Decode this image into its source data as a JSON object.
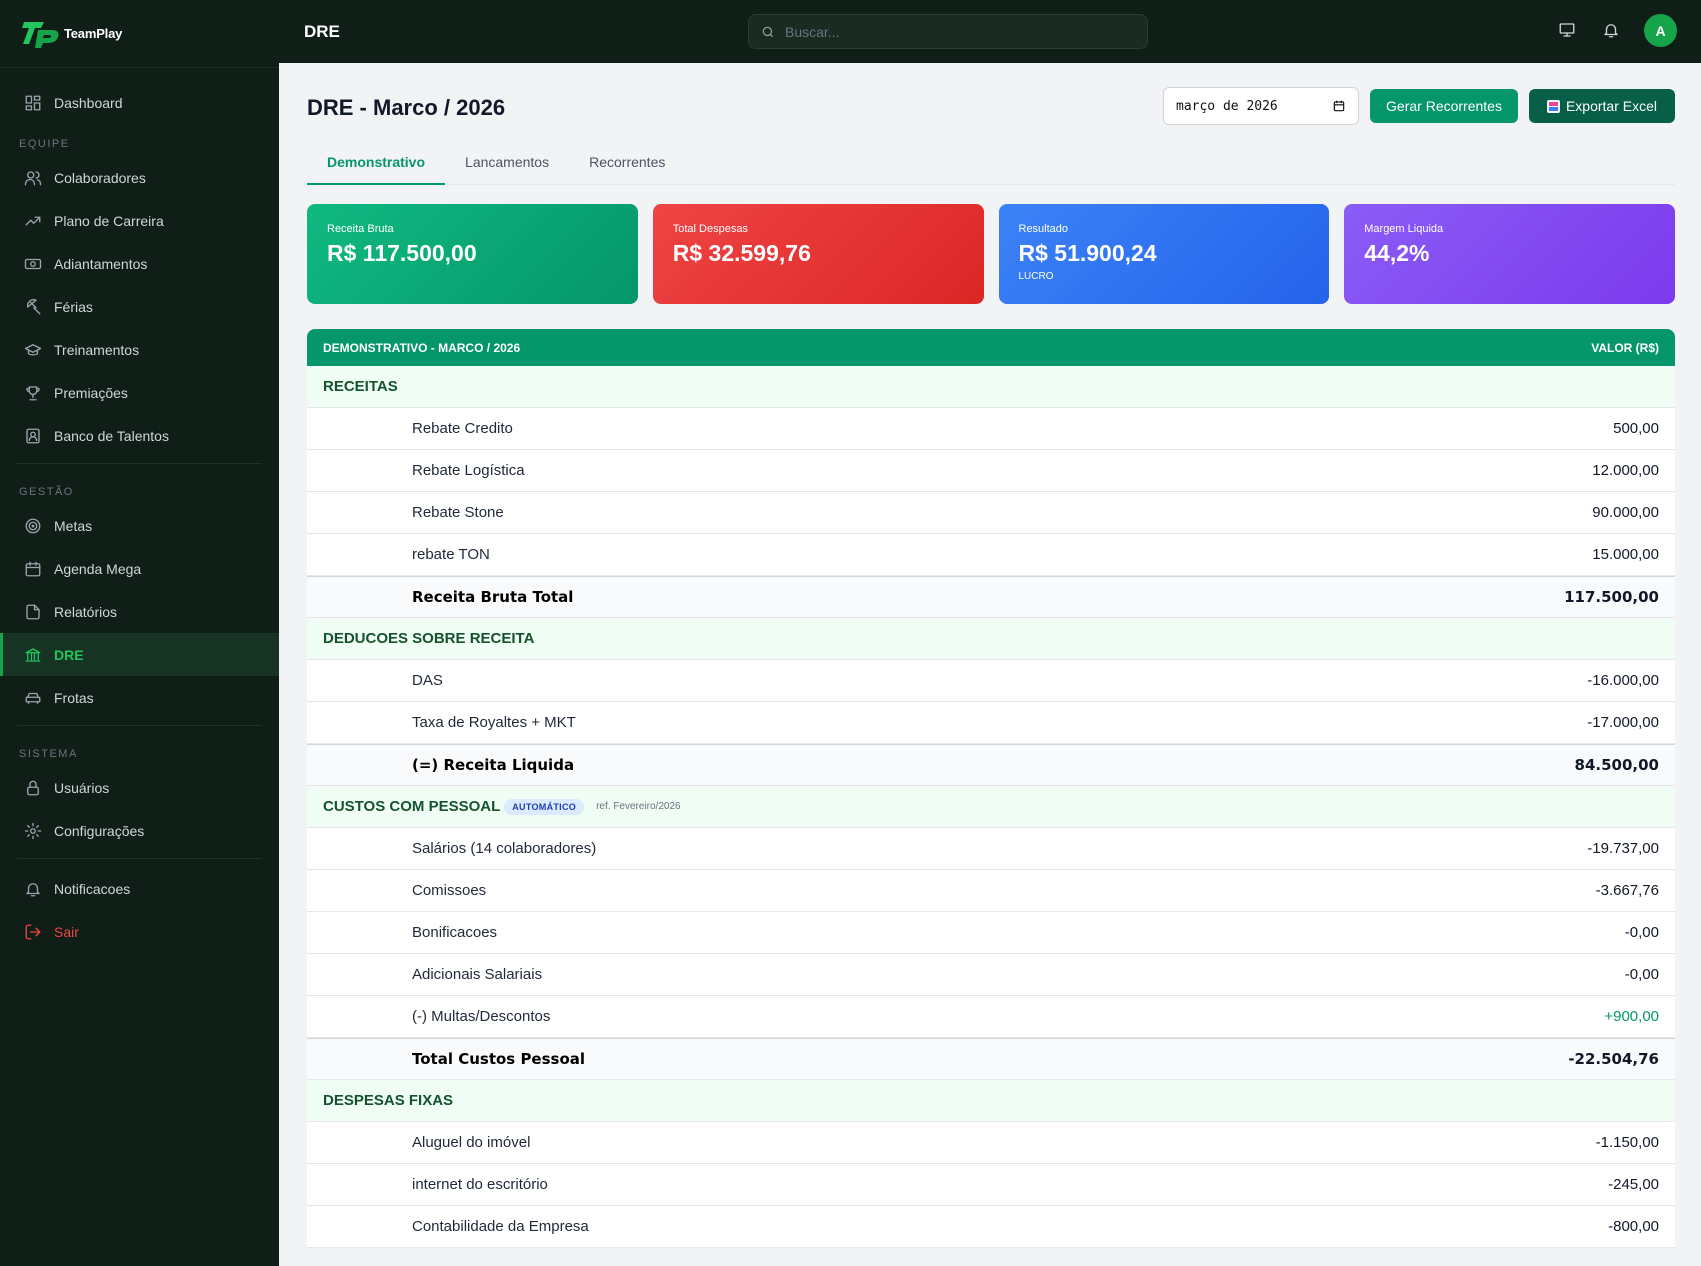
{
  "brand": {
    "name": "TeamPlay"
  },
  "sidebar": {
    "top": [
      {
        "label": "Dashboard",
        "icon": "dashboard-icon"
      }
    ],
    "equipe_title": "EQUIPE",
    "equipe": [
      {
        "label": "Colaboradores",
        "icon": "users-icon"
      },
      {
        "label": "Plano de Carreira",
        "icon": "trending-up-icon"
      },
      {
        "label": "Adiantamentos",
        "icon": "banknote-icon"
      },
      {
        "label": "Férias",
        "icon": "umbrella-icon"
      },
      {
        "label": "Treinamentos",
        "icon": "graduation-cap-icon"
      },
      {
        "label": "Premiações",
        "icon": "trophy-icon"
      },
      {
        "label": "Banco de Talentos",
        "icon": "contact-icon"
      }
    ],
    "gestao_title": "GESTÃO",
    "gestao": [
      {
        "label": "Metas",
        "icon": "target-icon"
      },
      {
        "label": "Agenda Mega",
        "icon": "calendar-icon"
      },
      {
        "label": "Relatórios",
        "icon": "file-icon"
      },
      {
        "label": "DRE",
        "icon": "bank-icon",
        "active": true
      },
      {
        "label": "Frotas",
        "icon": "car-icon"
      }
    ],
    "sistema_title": "SISTEMA",
    "sistema": [
      {
        "label": "Usuários",
        "icon": "lock-icon"
      },
      {
        "label": "Configurações",
        "icon": "gear-icon"
      }
    ],
    "bottom": [
      {
        "label": "Notificacoes",
        "icon": "bell-icon"
      },
      {
        "label": "Sair",
        "icon": "logout-icon"
      }
    ]
  },
  "topbar": {
    "title": "DRE",
    "search_placeholder": "Buscar...",
    "avatar": "A"
  },
  "page": {
    "title": "DRE - Marco / 2026",
    "month": "março de 2026",
    "btn_recorrentes": "Gerar Recorrentes",
    "btn_export": "Exportar Excel",
    "tabs": [
      "Demonstrativo",
      "Lancamentos",
      "Recorrentes"
    ]
  },
  "cards": [
    {
      "label": "Receita Bruta",
      "value": "R$ 117.500,00",
      "sub": ""
    },
    {
      "label": "Total Despesas",
      "value": "R$ 32.599,76",
      "sub": ""
    },
    {
      "label": "Resultado",
      "value": "R$ 51.900,24",
      "sub": "LUCRO"
    },
    {
      "label": "Margem Liquida",
      "value": "44,2%",
      "sub": ""
    }
  ],
  "table": {
    "head_left": "DEMONSTRATIVO - MARCO / 2026",
    "head_right": "VALOR (R$)",
    "receitas": {
      "title": "RECEITAS",
      "rows": [
        {
          "label": "Rebate Credito",
          "value": "500,00"
        },
        {
          "label": "Rebate Logística",
          "value": "12.000,00"
        },
        {
          "label": "Rebate Stone",
          "value": "90.000,00"
        },
        {
          "label": "rebate TON",
          "value": "15.000,00"
        }
      ],
      "total": {
        "label": "Receita Bruta Total",
        "value": "117.500,00"
      }
    },
    "deducoes": {
      "title": "DEDUCOES SOBRE RECEITA",
      "rows": [
        {
          "label": "DAS",
          "value": "-16.000,00"
        },
        {
          "label": "Taxa de Royaltes + MKT",
          "value": "-17.000,00"
        }
      ],
      "total": {
        "label": "(=) Receita Liquida",
        "value": "84.500,00"
      }
    },
    "pessoal": {
      "title": "CUSTOS COM PESSOAL",
      "badge": "AUTOMÁTICO",
      "ref": "ref. Fevereiro/2026",
      "rows": [
        {
          "label": "Salários (14 colaboradores)",
          "value": "-19.737,00"
        },
        {
          "label": "Comissoes",
          "value": "-3.667,76"
        },
        {
          "label": "Bonificacoes",
          "value": "-0,00"
        },
        {
          "label": "Adicionais Salariais",
          "value": "-0,00"
        },
        {
          "label": "(-) Multas/Descontos",
          "value": "+900,00"
        }
      ],
      "total": {
        "label": "Total Custos Pessoal",
        "value": "-22.504,76"
      }
    },
    "fixas": {
      "title": "DESPESAS FIXAS",
      "rows": [
        {
          "label": "Aluguel do imóvel",
          "value": "-1.150,00"
        },
        {
          "label": "internet do escritório",
          "value": "-245,00"
        },
        {
          "label": "Contabilidade da Empresa",
          "value": "-800,00"
        }
      ]
    }
  },
  "colors": {
    "accent": "#059669",
    "sidebar_bg": "#0f1f17",
    "positive": "#059669"
  }
}
